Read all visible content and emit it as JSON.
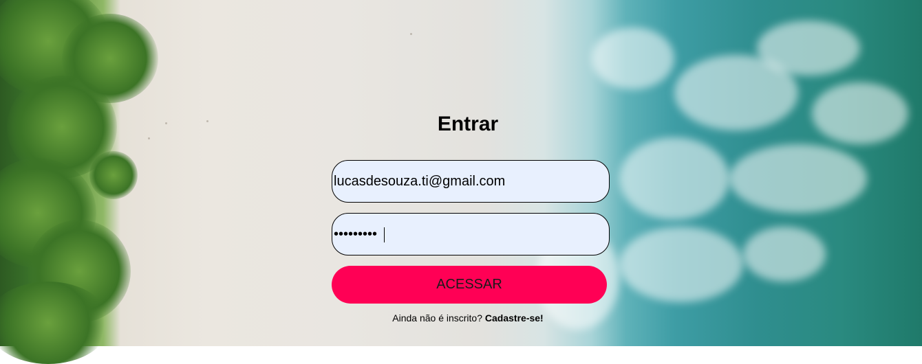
{
  "login": {
    "title": "Entrar",
    "email_value": "lucasdesouza.ti@gmail.com",
    "password_value": "•••••••••",
    "submit_label": "ACESSAR",
    "signup_prompt": "Ainda não é inscrito?",
    "signup_link": "Cadastre-se!"
  },
  "colors": {
    "accent": "#ff0055",
    "input_background": "#e8f0fe"
  },
  "background": {
    "image": "aerial-beach-photo"
  }
}
